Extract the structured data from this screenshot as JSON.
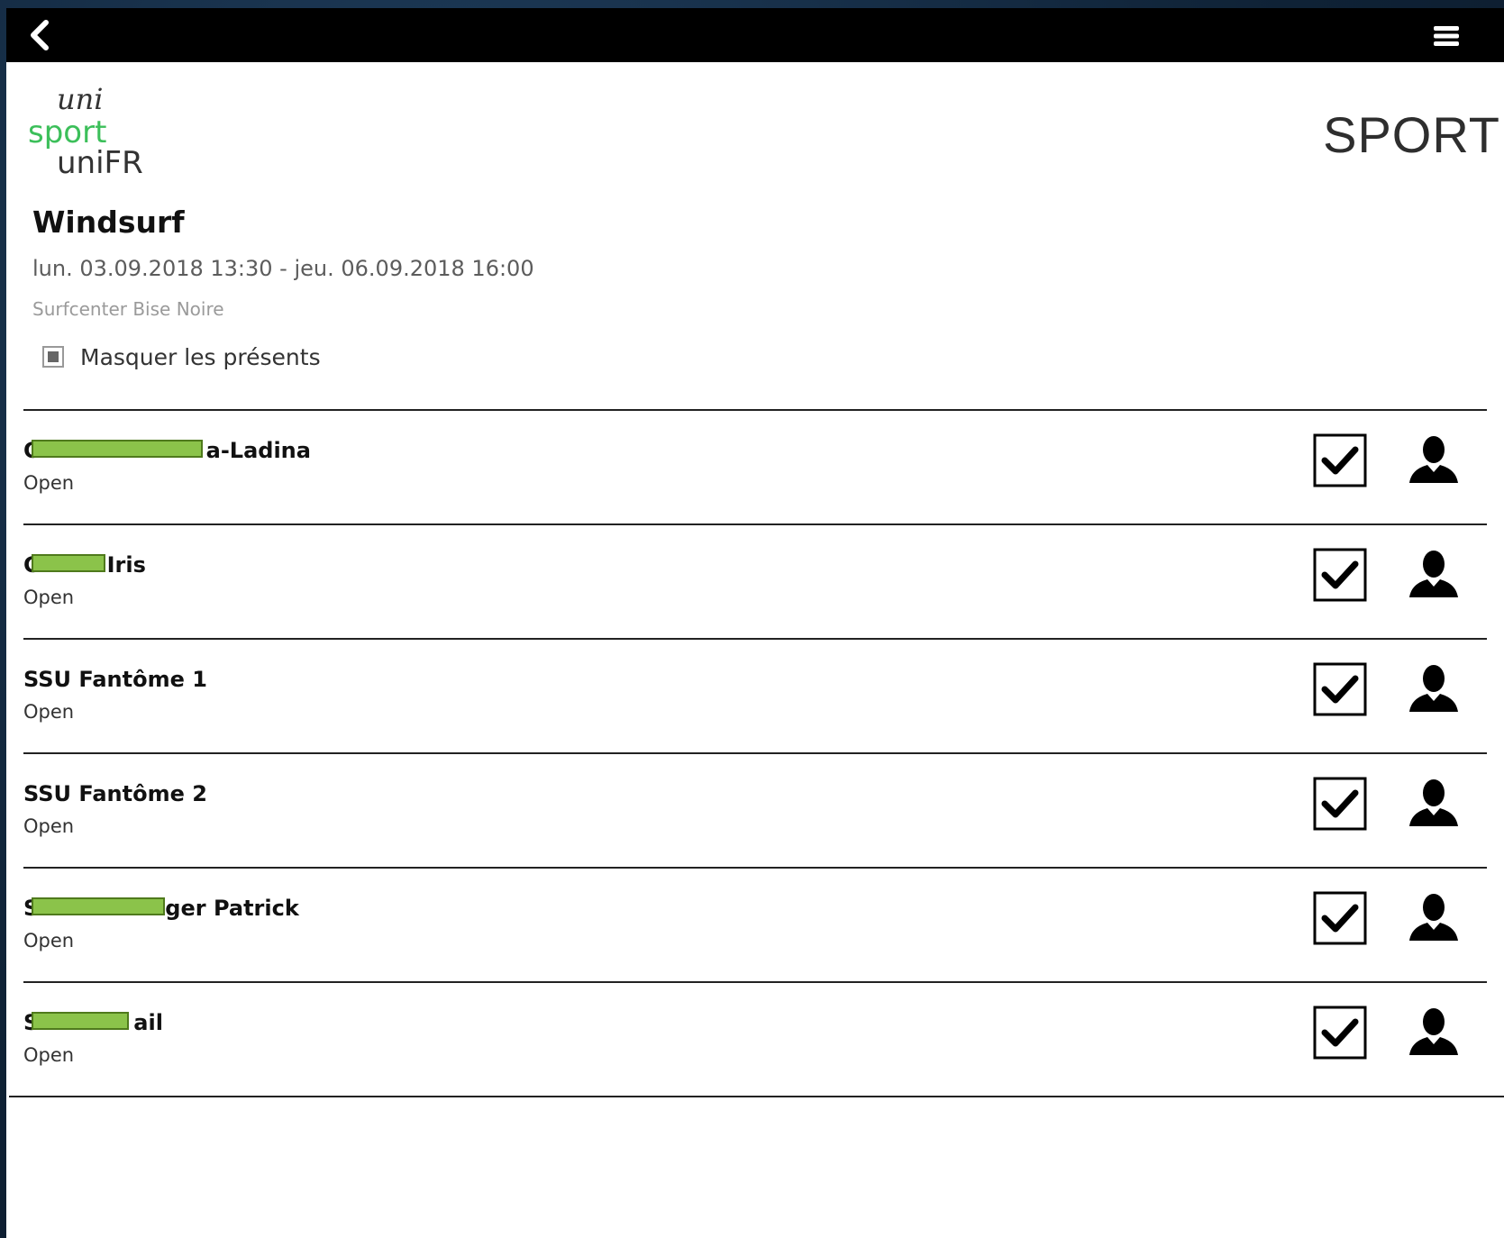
{
  "header": {
    "back_icon": "chevron-left-icon",
    "menu_icon": "hamburger-menu-icon",
    "bar_color": "#000000"
  },
  "logo": {
    "line1": "uni",
    "line2": "sport",
    "line3": "uniFR",
    "accent_color": "#3cbf5a"
  },
  "brand": "SPORT",
  "event": {
    "title": "Windsurf",
    "dates": "lun. 03.09.2018 13:30 - jeu. 06.09.2018 16:00",
    "location": "Surfcenter Bise Noire"
  },
  "filter": {
    "label": "Masquer les présents",
    "checked": "indeterminate"
  },
  "participants": [
    {
      "name_prefix": "C",
      "name_suffix": "a-Ladina",
      "status": "Open",
      "present": true
    },
    {
      "name_prefix": "C",
      "name_suffix": "Iris",
      "status": "Open",
      "present": true
    },
    {
      "name_prefix": "",
      "name_suffix": "SSU Fantôme 1",
      "status": "Open",
      "present": true
    },
    {
      "name_prefix": "",
      "name_suffix": "SSU Fantôme 2",
      "status": "Open",
      "present": true
    },
    {
      "name_prefix": "S",
      "name_suffix": "ger Patrick",
      "status": "Open",
      "present": true
    },
    {
      "name_prefix": "S",
      "name_suffix": "ail",
      "status": "Open",
      "present": true
    }
  ],
  "row_icons": {
    "check": "checkbox-checked-icon",
    "profile": "user-profile-icon"
  },
  "redaction_color": "#8bc34a"
}
